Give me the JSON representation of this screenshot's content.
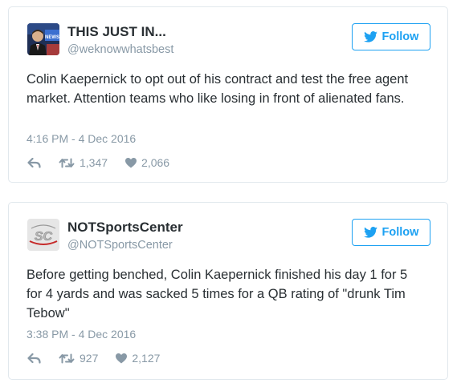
{
  "tweets": [
    {
      "name": "THIS JUST IN...",
      "handle": "@weknowwhatsbest",
      "follow_label": "Follow",
      "text": "Colin Kaepernick to opt out of his contract and test the free agent market. Attention teams who like losing in front of alienated fans.",
      "timestamp": "4:16 PM - 4 Dec 2016",
      "retweets": "1,347",
      "likes": "2,066",
      "avatar_badge": "NEWS"
    },
    {
      "name": "NOTSportsCenter",
      "handle": "@NOTSportsCenter",
      "follow_label": "Follow",
      "text": "Before getting benched, Colin Kaepernick finished his day 1 for 5 for 4 yards and was sacked 5 times for a QB rating of \"drunk Tim Tebow\"",
      "timestamp": "3:38 PM - 4 Dec 2016",
      "retweets": "927",
      "likes": "2,127",
      "avatar_badge": "SC"
    }
  ],
  "colors": {
    "twitter_blue": "#1da1f2",
    "text": "#292f33",
    "muted": "#8899a6",
    "border": "#e1e8ed"
  },
  "icons": [
    "reply-icon",
    "retweet-icon",
    "heart-icon",
    "twitter-bird-icon"
  ]
}
